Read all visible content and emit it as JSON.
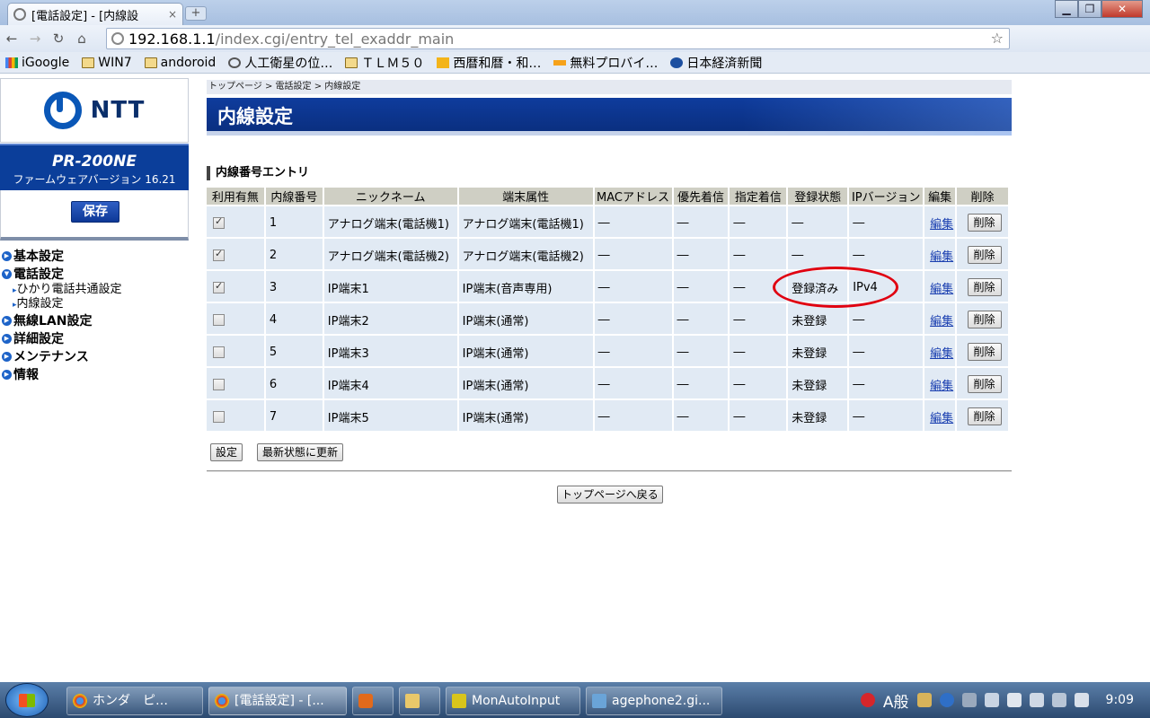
{
  "browser": {
    "tab_title": "[電話設定] - [内線設",
    "tab_close": "×",
    "new_tab": "+",
    "url_host": "192.168.1.1",
    "url_path": "/index.cgi/entry_tel_exaddr_main",
    "bookmarks": [
      "iGoogle",
      "WIN7",
      "andoroid",
      "人工衛星の位…",
      "ＴＬＭ５０",
      "西暦和暦・和…",
      "無料プロバイ…",
      "日本経済新聞"
    ]
  },
  "sidebar": {
    "logo_text": "NTT",
    "model": "PR-200NE",
    "firmware": "ファームウェアバージョン  16.21",
    "save_label": "保存",
    "menu": [
      {
        "label": "基本設定"
      },
      {
        "label": "電話設定"
      },
      {
        "label": "無線LAN設定"
      },
      {
        "label": "詳細設定"
      },
      {
        "label": "メンテナンス"
      },
      {
        "label": "情報"
      }
    ],
    "submenu": [
      "ひかり電話共通設定",
      "内線設定"
    ]
  },
  "main": {
    "breadcrumb": "トップページ > 電話設定 > 内線設定",
    "title": "内線設定",
    "section_title": "内線番号エントリ",
    "columns": [
      "利用有無",
      "内線番号",
      "ニックネーム",
      "端末属性",
      "MACアドレス",
      "優先着信",
      "指定着信",
      "登録状態",
      "IPバージョン",
      "編集",
      "削除"
    ],
    "rows": [
      {
        "checked": true,
        "no": "1",
        "nickname": "アナログ端末(電話機1)",
        "attr": "アナログ端末(電話機1)",
        "mac": "―",
        "priority": "―",
        "designated": "―",
        "status": "―",
        "ipver": "―",
        "edit": "編集",
        "del": "削除"
      },
      {
        "checked": true,
        "no": "2",
        "nickname": "アナログ端末(電話機2)",
        "attr": "アナログ端末(電話機2)",
        "mac": "―",
        "priority": "―",
        "designated": "―",
        "status": "―",
        "ipver": "―",
        "edit": "編集",
        "del": "削除"
      },
      {
        "checked": true,
        "no": "3",
        "nickname": "IP端末1",
        "attr": "IP端末(音声専用)",
        "mac": "―",
        "priority": "―",
        "designated": "―",
        "status": "登録済み",
        "ipver": "IPv4",
        "edit": "編集",
        "del": "削除"
      },
      {
        "checked": false,
        "no": "4",
        "nickname": "IP端末2",
        "attr": "IP端末(通常)",
        "mac": "―",
        "priority": "―",
        "designated": "―",
        "status": "未登録",
        "ipver": "―",
        "edit": "編集",
        "del": "削除"
      },
      {
        "checked": false,
        "no": "5",
        "nickname": "IP端末3",
        "attr": "IP端末(通常)",
        "mac": "―",
        "priority": "―",
        "designated": "―",
        "status": "未登録",
        "ipver": "―",
        "edit": "編集",
        "del": "削除"
      },
      {
        "checked": false,
        "no": "6",
        "nickname": "IP端末4",
        "attr": "IP端末(通常)",
        "mac": "―",
        "priority": "―",
        "designated": "―",
        "status": "未登録",
        "ipver": "―",
        "edit": "編集",
        "del": "削除"
      },
      {
        "checked": false,
        "no": "7",
        "nickname": "IP端末5",
        "attr": "IP端末(通常)",
        "mac": "―",
        "priority": "―",
        "designated": "―",
        "status": "未登録",
        "ipver": "―",
        "edit": "編集",
        "del": "削除"
      }
    ],
    "set_button": "設定",
    "refresh_button": "最新状態に更新",
    "top_button": "トップページへ戻る"
  },
  "taskbar": {
    "items": [
      "ホンダ　ピ…",
      "[電話設定] - [...",
      "",
      "",
      "MonAutoInput",
      "agephone2.gi..."
    ],
    "ime": "A般",
    "clock": "9:09"
  },
  "colors": {
    "title_bar": "#0f3c9d",
    "model_box": "#0b3e9a",
    "row_bg": "#e1eaf4",
    "header_bg": "#cfcfc4",
    "highlight_ellipse": "#e00010"
  }
}
